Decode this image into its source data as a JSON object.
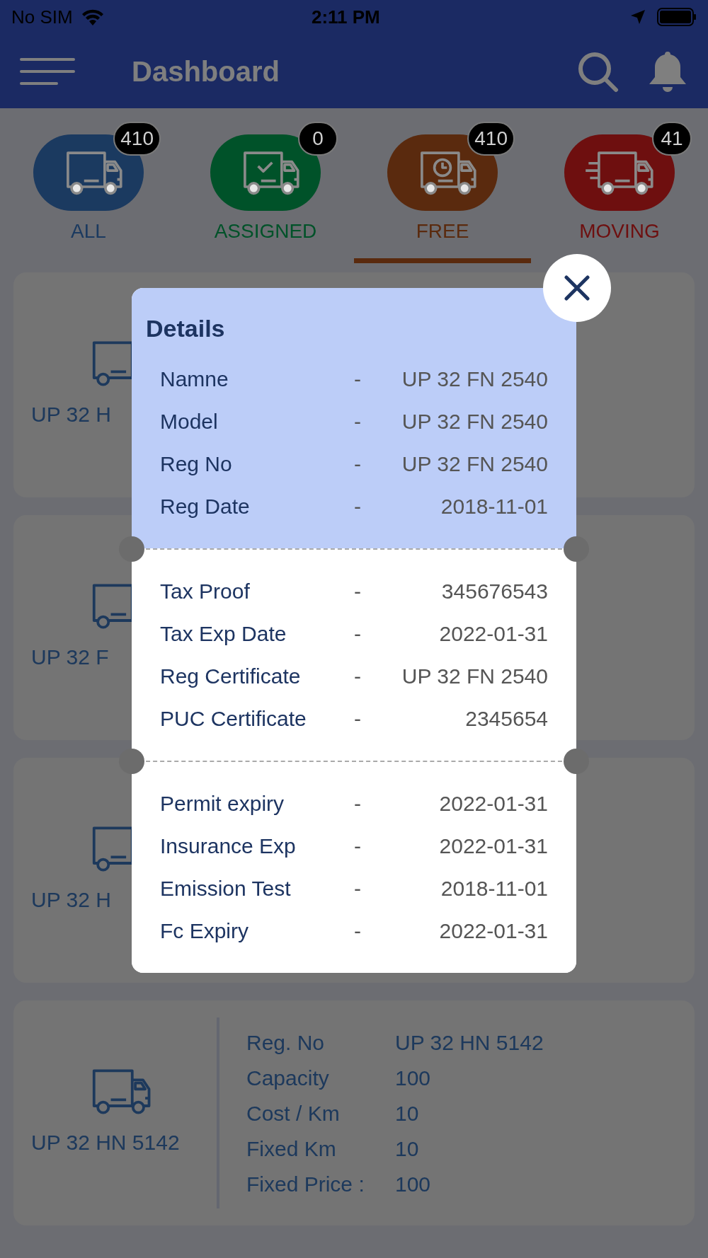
{
  "status_bar": {
    "carrier": "No SIM",
    "time": "2:11 PM"
  },
  "header": {
    "title": "Dashboard"
  },
  "tabs": [
    {
      "label": "ALL",
      "count": "410",
      "kind": "all",
      "color": "#1b3a60",
      "selected": false
    },
    {
      "label": "ASSIGNED",
      "count": "0",
      "kind": "assigned",
      "color": "#005229",
      "selected": false
    },
    {
      "label": "FREE",
      "count": "410",
      "kind": "free",
      "color": "#5a2a0e",
      "selected": true
    },
    {
      "label": "MOVING",
      "count": "41",
      "kind": "moving",
      "color": "#6e0f0f",
      "selected": false
    }
  ],
  "vehicles": [
    {
      "plate": "UP 32 H"
    },
    {
      "plate": "UP 32 F"
    },
    {
      "plate": "UP 32 H"
    },
    {
      "plate": "UP 32 HN 5142",
      "fields": [
        {
          "label": "Reg. No",
          "value": "UP 32 HN 5142"
        },
        {
          "label": "Capacity",
          "value": "100"
        },
        {
          "label": "Cost / Km",
          "value": "10"
        },
        {
          "label": "Fixed Km",
          "value": "10"
        },
        {
          "label": "Fixed Price :",
          "value": "100"
        }
      ]
    }
  ],
  "dialog": {
    "title": "Details",
    "sections": [
      {
        "highlighted": true,
        "rows": [
          {
            "label": "Namne",
            "separator": "-",
            "value": "UP 32 FN 2540"
          },
          {
            "label": "Model",
            "separator": "-",
            "value": "UP 32 FN 2540"
          },
          {
            "label": "Reg No",
            "separator": "-",
            "value": "UP 32 FN 2540"
          },
          {
            "label": "Reg Date",
            "separator": "-",
            "value": "2018-11-01"
          }
        ]
      },
      {
        "highlighted": false,
        "rows": [
          {
            "label": "Tax Proof",
            "separator": "-",
            "value": "345676543"
          },
          {
            "label": "Tax Exp Date",
            "separator": "-",
            "value": "2022-01-31"
          },
          {
            "label": "Reg Certificate",
            "separator": "-",
            "value": "UP 32 FN 2540"
          },
          {
            "label": "PUC Certificate",
            "separator": "-",
            "value": "2345654"
          }
        ]
      },
      {
        "highlighted": false,
        "rows": [
          {
            "label": "Permit expiry",
            "separator": "-",
            "value": "2022-01-31"
          },
          {
            "label": "Insurance Exp",
            "separator": "-",
            "value": "2022-01-31"
          },
          {
            "label": "Emission Test",
            "separator": "-",
            "value": "2018-11-01"
          },
          {
            "label": "Fc Expiry",
            "separator": "-",
            "value": "2022-01-31"
          }
        ]
      }
    ]
  }
}
